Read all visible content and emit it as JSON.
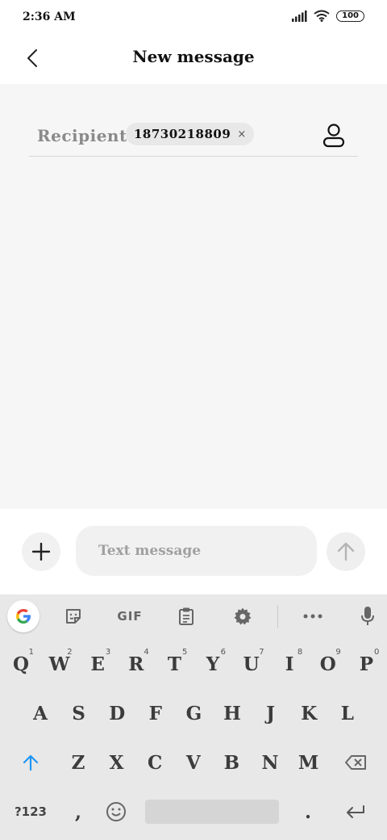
{
  "status_bar": {
    "time": "2:36 AM",
    "battery": "100"
  },
  "header": {
    "title": "New message"
  },
  "recipient": {
    "label": "Recipient:",
    "number": "18730218809",
    "remove": "×"
  },
  "compose": {
    "placeholder": "Text message"
  },
  "keyboard": {
    "gif_label": "GIF",
    "row1": [
      {
        "key": "Q",
        "hint": "1"
      },
      {
        "key": "W",
        "hint": "2"
      },
      {
        "key": "E",
        "hint": "3"
      },
      {
        "key": "R",
        "hint": "4"
      },
      {
        "key": "T",
        "hint": "5"
      },
      {
        "key": "Y",
        "hint": "6"
      },
      {
        "key": "U",
        "hint": "7"
      },
      {
        "key": "I",
        "hint": "8"
      },
      {
        "key": "O",
        "hint": "9"
      },
      {
        "key": "P",
        "hint": "0"
      }
    ],
    "row2": [
      "A",
      "S",
      "D",
      "F",
      "G",
      "H",
      "J",
      "K",
      "L"
    ],
    "row3": [
      "Z",
      "X",
      "C",
      "V",
      "B",
      "N",
      "M"
    ],
    "symbols_key": "?123",
    "comma_key": ",",
    "period_key": "."
  },
  "icons": {
    "back": "chevron-left-icon",
    "contact": "person-icon",
    "add": "plus-icon",
    "send": "arrow-up-icon",
    "google": "google-g-icon",
    "sticker": "sticker-icon",
    "clipboard": "clipboard-icon",
    "settings": "gear-icon",
    "more": "more-horizontal-icon",
    "mic": "microphone-icon",
    "shift": "shift-arrow-icon",
    "backspace": "backspace-icon",
    "emoji": "emoji-icon",
    "enter": "enter-icon"
  },
  "colors": {
    "accent_shift": "#2196f3",
    "main_bg": "#f6f6f6",
    "keyboard_bg": "#e8e8e8"
  }
}
